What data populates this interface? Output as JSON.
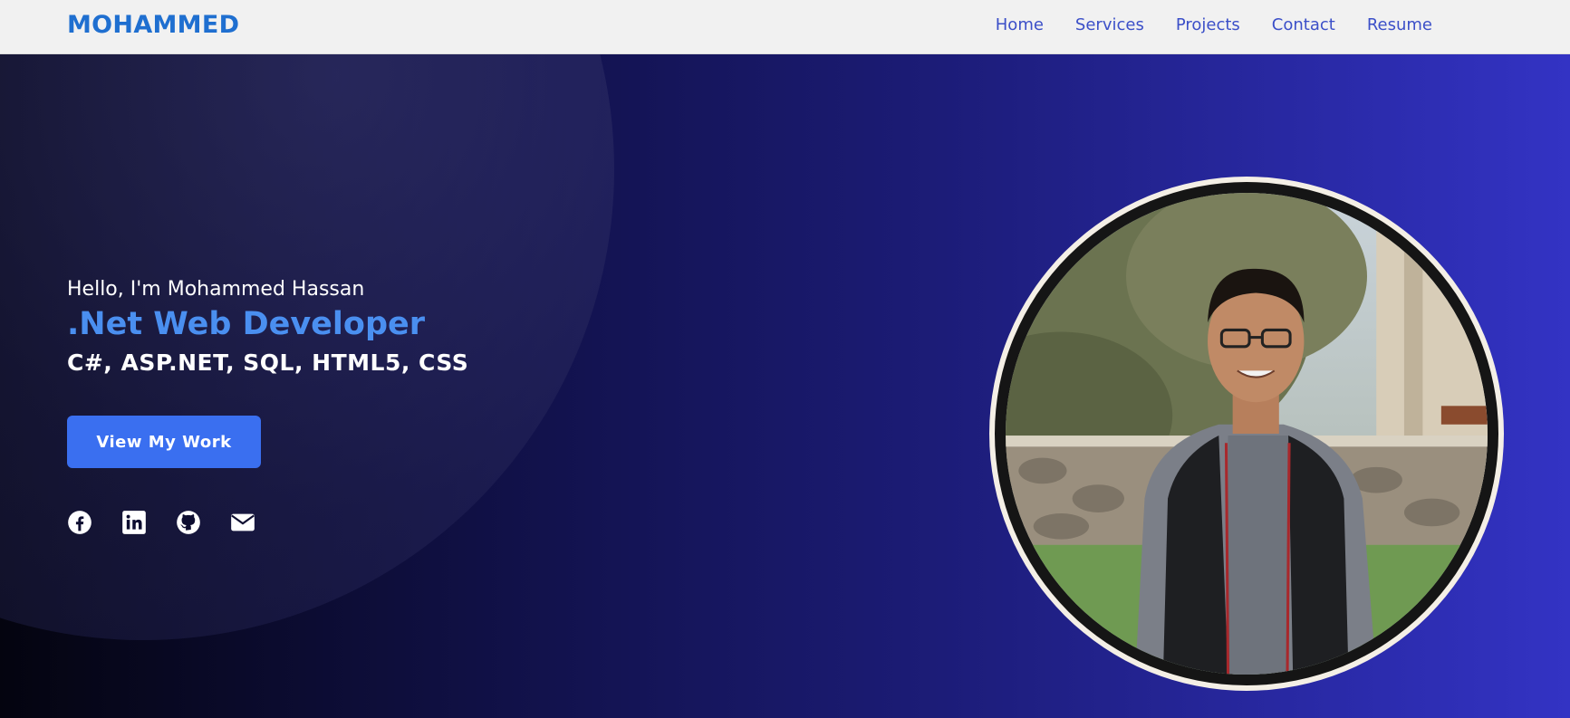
{
  "header": {
    "brand": "MOHAMMED",
    "nav": [
      "Home",
      "Services",
      "Projects",
      "Contact",
      "Resume"
    ]
  },
  "hero": {
    "greeting": "Hello, I'm Mohammed Hassan",
    "role": ".Net Web Developer",
    "skills": "C#, ASP.NET, SQL, HTML5, CSS",
    "cta_label": "View My Work",
    "socials": [
      "facebook-icon",
      "linkedin-icon",
      "github-icon",
      "email-icon"
    ]
  },
  "colors": {
    "brand": "#1f6fd0",
    "nav_link": "#3b4fc8",
    "role": "#4a8ff0",
    "button": "#3a6ff0"
  }
}
